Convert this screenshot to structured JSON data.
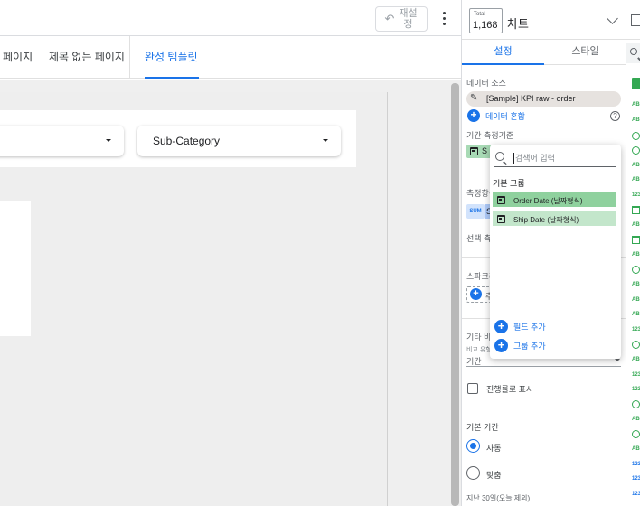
{
  "toolbar": {
    "reset_label": "재설정"
  },
  "page_tabs": [
    {
      "label": "페이지"
    },
    {
      "label": "제목 없는 페이지"
    },
    {
      "label": "완성 템플릿"
    }
  ],
  "canvas": {
    "controls": [
      {
        "label": ""
      },
      {
        "label": "Sub-Category"
      }
    ]
  },
  "panel": {
    "chart_badge": {
      "caption": "Total",
      "value": "1,168"
    },
    "title": "차트",
    "tabs": [
      {
        "label": "설정"
      },
      {
        "label": "스타일"
      }
    ],
    "data_source_label": "데이터 소스",
    "data_source_name": "[Sample] KPI raw - order",
    "blend_label": "데이터 혼합",
    "date_range_label": "기간 측정기준",
    "date_chip_text": "S",
    "metric_label": "측정항목",
    "metric_agg": "SUM",
    "metric_chip_text": "S",
    "optional_metric_label": "선택 측정",
    "sparkline_label": "스파크라",
    "sparkline_add": "추",
    "comparison_label": "기타 비교",
    "comparison_small": "비교 유형",
    "comparison_value": "기간",
    "progress_label": "진행률로 표시",
    "default_range_label": "기본 기간",
    "radio_auto": "자동",
    "radio_custom": "맞춤",
    "default_range_hint": "지난 30일(오늘 제외)"
  },
  "popup": {
    "search_placeholder": "검색어 입력",
    "group_title": "기본 그룹",
    "fields": [
      {
        "label": "Order Date (날짜형식)",
        "color": "#8fd19e"
      },
      {
        "label": "Ship Date (날짜형식)",
        "color": "#c3e6cb"
      }
    ],
    "add_field": "필드 추가",
    "add_group": "그룹 추가"
  },
  "colors": {
    "accent": "#1a73e8",
    "dimension_green": "#34a853"
  }
}
